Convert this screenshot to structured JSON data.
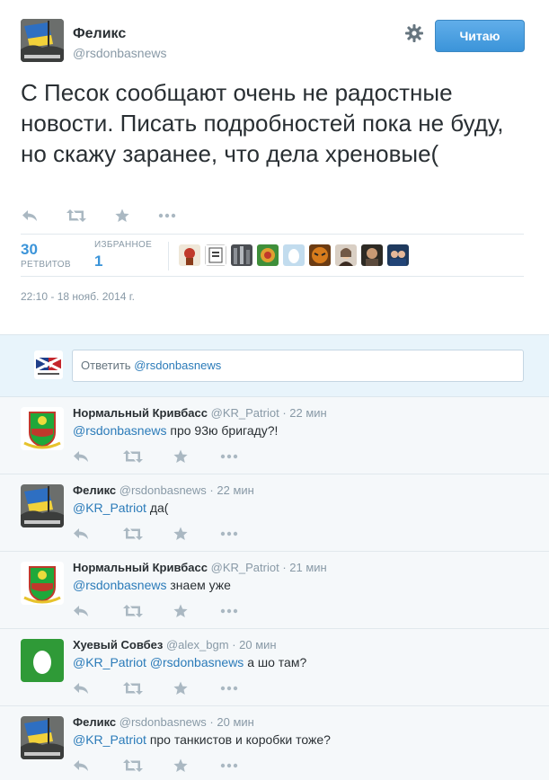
{
  "tweet": {
    "author_name": "Феликс",
    "author_handle": "@rsdonbasnews",
    "follow_label": "Читаю",
    "text": "С Песок сообщают очень не радостные новости. Писать подробностей пока не буду, но скажу заранее, что дела хреновые(",
    "retweets_count": "30",
    "retweets_label": "РЕТВИТОВ",
    "favorites_count": "1",
    "favorites_label": "ИЗБРАННОЕ",
    "timestamp": "22:10 - 18 нояб. 2014 г."
  },
  "icons": {
    "settings": "gear-icon",
    "reply": "reply-icon",
    "retweet": "retweet-icon",
    "favorite": "star-icon",
    "more": "more-icon"
  },
  "composer": {
    "prefix": "Ответить ",
    "mention": "@rsdonbasnews"
  },
  "replies": [
    {
      "name": "Нормальный Кривбасс",
      "handle": "@KR_Patriot",
      "time": "22 мин",
      "mentions": [
        "@rsdonbasnews"
      ],
      "text": "про 93ю бригаду?!",
      "avatar": "coat-of-arms"
    },
    {
      "name": "Феликс",
      "handle": "@rsdonbasnews",
      "time": "22 мин",
      "mentions": [
        "@KR_Patriot"
      ],
      "text": "да(",
      "avatar": "flag"
    },
    {
      "name": "Нормальный Кривбасс",
      "handle": "@KR_Patriot",
      "time": "21 мин",
      "mentions": [
        "@rsdonbasnews"
      ],
      "text": "знаем уже",
      "avatar": "coat-of-arms"
    },
    {
      "name": "Хуевый Совбез",
      "handle": "@alex_bgm",
      "time": "20 мин",
      "mentions": [
        "@KR_Patriot",
        "@rsdonbasnews"
      ],
      "text": "а шо там?",
      "avatar": "egg"
    },
    {
      "name": "Феликс",
      "handle": "@rsdonbasnews",
      "time": "20 мин",
      "mentions": [
        "@KR_Patriot"
      ],
      "text": "про танкистов и коробки тоже?",
      "avatar": "flag"
    }
  ],
  "colors": {
    "link": "#2b7bb9",
    "stat_number": "#3b94d9",
    "muted": "#8899a6",
    "button": "#3b94d9",
    "reply_bg": "#f5f8fa",
    "composer_bg": "#e8f4fb"
  }
}
